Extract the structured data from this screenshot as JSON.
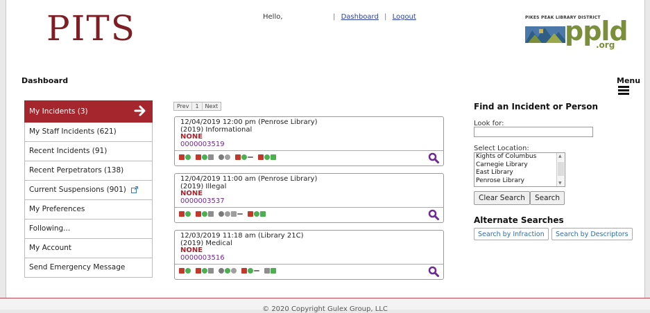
{
  "header": {
    "logo": "PITS",
    "greeting": "Hello,",
    "links": {
      "dashboard": "Dashboard",
      "logout": "Logout",
      "separator": "|"
    },
    "library": {
      "title": "PIKES PEAK LIBRARY DISTRICT",
      "letters": "ppld",
      "domain": ".org"
    }
  },
  "page": {
    "title": "Dashboard",
    "menu_label": "Menu"
  },
  "sidebar": {
    "items": [
      {
        "label": "My Incidents (3)"
      },
      {
        "label": "My Staff Incidents (621)"
      },
      {
        "label": "Recent Incidents (91)"
      },
      {
        "label": "Recent Perpetrators (138)"
      },
      {
        "label": "Current Suspensions (901)"
      },
      {
        "label": "My Preferences"
      },
      {
        "label": "Following..."
      },
      {
        "label": "My Account"
      },
      {
        "label": "Send Emergency Message"
      }
    ]
  },
  "pager": {
    "prev": "Prev",
    "page": "1",
    "next": "Next"
  },
  "incidents": [
    {
      "datetime": "12/04/2019 12:00 pm (Penrose Library)",
      "type": "(2019) Informational",
      "status": "NONE",
      "number": "0000003519"
    },
    {
      "datetime": "12/04/2019 11:00 am (Penrose Library)",
      "type": "(2019) Illegal",
      "status": "NONE",
      "number": "0000003537"
    },
    {
      "datetime": "12/03/2019 11:18 am (Library 21C)",
      "type": "(2019) Medical",
      "status": "NONE",
      "number": "0000003516"
    }
  ],
  "search": {
    "title": "Find an Incident or Person",
    "look_for_label": "Look for:",
    "look_for_value": "",
    "location_label": "Select Location:",
    "locations": [
      "Kights of Columbus",
      "Carnegie Library",
      "East Library",
      "Penrose Library"
    ],
    "clear_label": "Clear Search",
    "search_label": "Search"
  },
  "alternate": {
    "title": "Alternate Searches",
    "by_infraction": "Search by Infraction",
    "by_descriptors": "Search by Descriptors"
  },
  "footer": {
    "copyright": "© 2020 Copyright Gulex Group, LLC"
  },
  "colors": {
    "accent": "#a6262e",
    "logo": "#7d1e24",
    "link": "#2b3f9e",
    "number": "#6d2a8f",
    "ppld_green": "#7b8f3a"
  }
}
